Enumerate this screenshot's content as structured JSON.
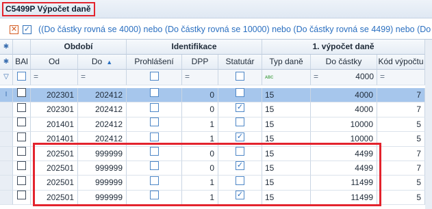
{
  "window": {
    "title": "C5499P Výpočet daně"
  },
  "filter": {
    "text": "((Do částky rovná se 4000) nebo (Do částky rovná se 10000) nebo (Do částky rovná se 4499) nebo (Do"
  },
  "groups": {
    "obdobi": "Období",
    "identifikace": "Identifikace",
    "vypocet": "1. výpočet daně"
  },
  "columns": {
    "bal": "BAl",
    "od": "Od",
    "do": "Do",
    "prohlaseni": "Prohlášení",
    "dpp": "DPP",
    "statutar": "Statutár",
    "typ_dane": "Typ daně",
    "do_castky": "Do částky",
    "kod_vypoctu": "Kód výpočtu"
  },
  "filter_row": {
    "do_castky": "4000"
  },
  "rows": [
    {
      "od": "202301",
      "do": "202412",
      "dpp": "0",
      "typ": "15",
      "castka": "4000",
      "kod": "7",
      "statutar": false,
      "selected": true
    },
    {
      "od": "202301",
      "do": "202412",
      "dpp": "0",
      "typ": "15",
      "castka": "4000",
      "kod": "7",
      "statutar": true,
      "selected": false
    },
    {
      "od": "201401",
      "do": "202412",
      "dpp": "1",
      "typ": "15",
      "castka": "10000",
      "kod": "5",
      "statutar": false,
      "selected": false
    },
    {
      "od": "201401",
      "do": "202412",
      "dpp": "1",
      "typ": "15",
      "castka": "10000",
      "kod": "5",
      "statutar": true,
      "selected": false
    },
    {
      "od": "202501",
      "do": "999999",
      "dpp": "0",
      "typ": "15",
      "castka": "4499",
      "kod": "7",
      "statutar": false,
      "selected": false
    },
    {
      "od": "202501",
      "do": "999999",
      "dpp": "0",
      "typ": "15",
      "castka": "4499",
      "kod": "7",
      "statutar": true,
      "selected": false
    },
    {
      "od": "202501",
      "do": "999999",
      "dpp": "1",
      "typ": "15",
      "castka": "11499",
      "kod": "5",
      "statutar": false,
      "selected": false
    },
    {
      "od": "202501",
      "do": "999999",
      "dpp": "1",
      "typ": "15",
      "castka": "11499",
      "kod": "5",
      "statutar": true,
      "selected": false
    }
  ]
}
